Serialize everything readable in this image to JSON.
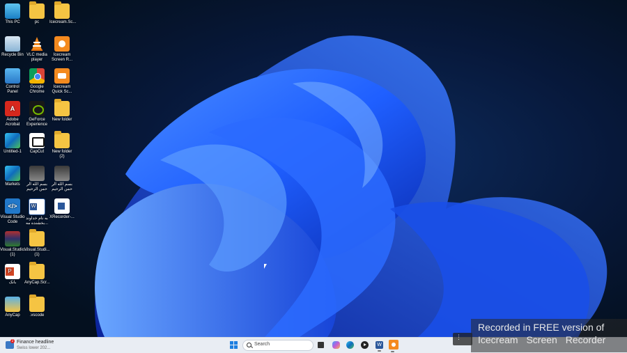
{
  "desktop": {
    "icons": [
      {
        "label": "This PC",
        "icon": "computer-icon"
      },
      {
        "label": "pc",
        "icon": "folder-icon"
      },
      {
        "label": "Icecream.Sc...",
        "icon": "folder-icon"
      },
      {
        "label": "Recycle Bin",
        "icon": "recycle-bin-icon"
      },
      {
        "label": "VLC media player",
        "icon": "vlc-icon"
      },
      {
        "label": "Icecream Screen R...",
        "icon": "icecream-recorder-icon"
      },
      {
        "label": "Control Panel",
        "icon": "control-panel-icon"
      },
      {
        "label": "Google Chrome",
        "icon": "chrome-icon"
      },
      {
        "label": "Icecream Quick Sc...",
        "icon": "icecream-quick-icon"
      },
      {
        "label": "Adobe Acrobat",
        "icon": "acrobat-icon"
      },
      {
        "label": "GeForce Experience",
        "icon": "nvidia-icon"
      },
      {
        "label": "New folder",
        "icon": "folder-icon"
      },
      {
        "label": "Untitled-1",
        "icon": "edge-icon"
      },
      {
        "label": "CapCut",
        "icon": "capcut-icon"
      },
      {
        "label": "New folder (2)",
        "icon": "folder-icon"
      },
      {
        "label": "Markets",
        "icon": "edge-icon"
      },
      {
        "label": "بسم الله الر حمن الرحيم",
        "icon": "image-file-icon"
      },
      {
        "label": "بسم الله الر حمن الرحيم",
        "icon": "image-file-icon"
      },
      {
        "label": "Visual Studio Code",
        "icon": "vscode-icon"
      },
      {
        "label": "به نام خداوند بخشنده مه...",
        "icon": "word-doc-icon"
      },
      {
        "label": "XRecorder-...",
        "icon": "document-icon"
      },
      {
        "label": "Visual.Studio... (1)",
        "icon": "winrar-icon"
      },
      {
        "label": "Visual.Studi... (1)",
        "icon": "folder-icon"
      },
      {
        "label": "بانک",
        "icon": "powerpoint-icon"
      },
      {
        "label": "AnyCap.Scr...",
        "icon": "folder-icon"
      },
      {
        "label": "AnyCap",
        "icon": "anycap-icon"
      },
      {
        "label": ".vscode",
        "icon": "folder-icon"
      }
    ]
  },
  "taskbar": {
    "weather_title": "Finance headline",
    "weather_sub": "Swiss lower 202...",
    "notification_count": "2",
    "search_placeholder": "Search",
    "pinned": [
      "task-view-icon",
      "copilot-icon",
      "edge-icon",
      "media-player-icon",
      "word-icon",
      "icecream-recorder-icon"
    ]
  },
  "watermark": {
    "line1": "Recorded in FREE version of",
    "line2": "Icecream Screen Recorder"
  },
  "colors": {
    "accent": "#1e7fe0",
    "taskbar_bg": "#e9edf3",
    "wallpaper_dark": "#04101f",
    "bloom_blue": "#1f5fff"
  }
}
